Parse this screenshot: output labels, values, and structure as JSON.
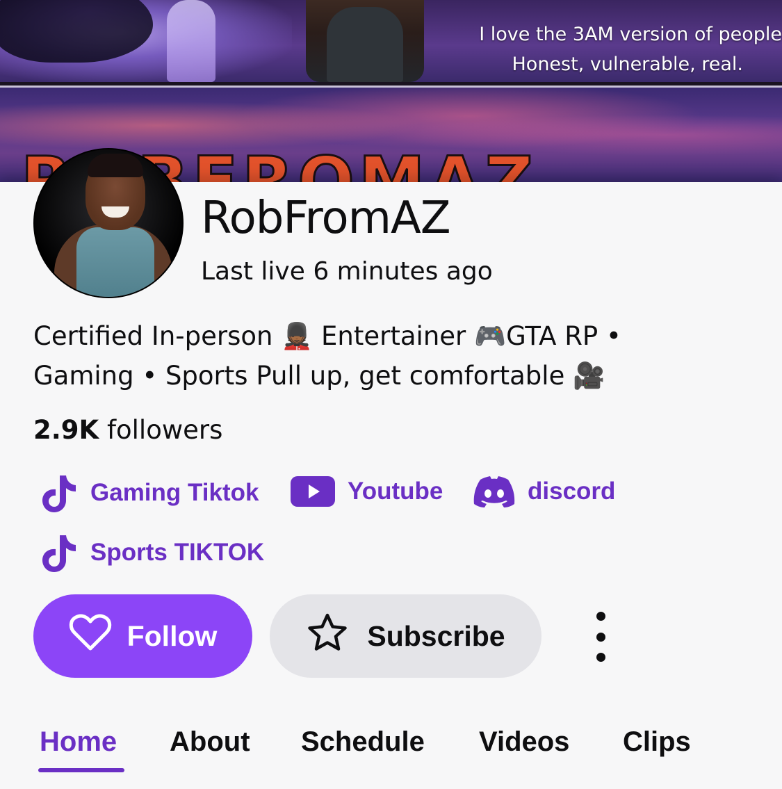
{
  "banner": {
    "quote_line1": "I love the 3AM version of people",
    "quote_line2": "Honest, vulnerable, real.",
    "big_text": "ROBFROMAZ"
  },
  "profile": {
    "name": "RobFromAZ",
    "last_live": "Last live 6 minutes ago",
    "bio_line1": "Certified In-person 💂🏾 Entertainer 🎮GTA RP •",
    "bio_line2": "Gaming • Sports Pull up, get comfortable 🎥",
    "followers_count": "2.9K",
    "followers_label": "followers"
  },
  "social_links": [
    {
      "label": "Gaming Tiktok",
      "icon": "tiktok-icon"
    },
    {
      "label": "Youtube",
      "icon": "youtube-icon"
    },
    {
      "label": "discord",
      "icon": "discord-icon"
    },
    {
      "label": "Sports TIKTOK",
      "icon": "tiktok-icon"
    }
  ],
  "actions": {
    "follow_label": "Follow",
    "subscribe_label": "Subscribe"
  },
  "tabs": [
    {
      "label": "Home",
      "active": true
    },
    {
      "label": "About",
      "active": false
    },
    {
      "label": "Schedule",
      "active": false
    },
    {
      "label": "Videos",
      "active": false
    },
    {
      "label": "Clips",
      "active": false
    }
  ],
  "colors": {
    "accent": "#8c45f7",
    "link": "#6a2fc4",
    "background": "#f7f7f8",
    "subscribe_bg": "#e4e4e8"
  }
}
